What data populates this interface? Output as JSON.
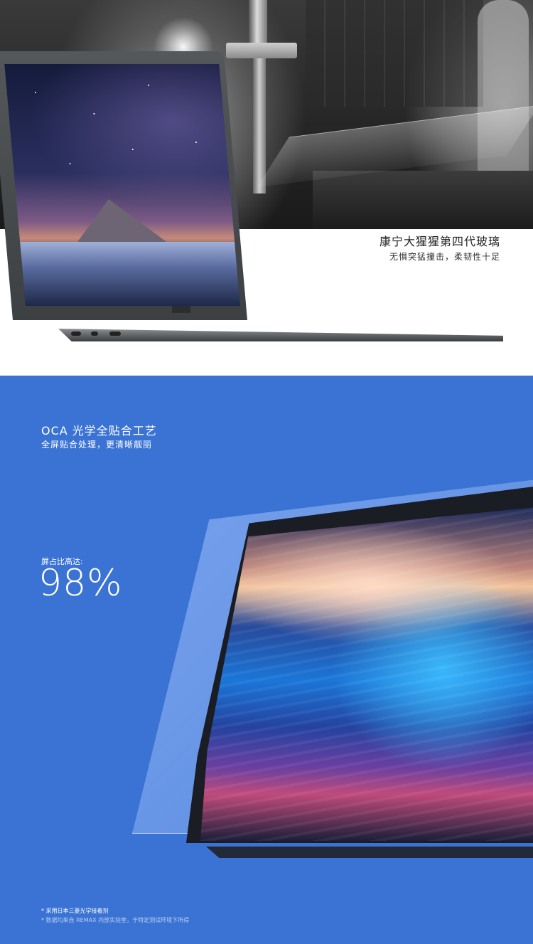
{
  "glass_section": {
    "title": "康宁大猩猩第四代玻璃",
    "subtitle": "无惧突猛撞击，柔韧性十足"
  },
  "oca_section": {
    "title": "OCA 光学全贴合工艺",
    "subtitle": "全屏贴合处理，更清晰靓丽",
    "ratio_label": "屏占比高达:",
    "ratio_value": "98%",
    "footnote_1": "* 采用日本三菱光学接着剂",
    "footnote_2": "* 数据均来自 REMAX 内部实验室，于特定测试环境下所得"
  },
  "colors": {
    "section2_background": "#3a73d4",
    "text_dark": "#222222",
    "text_light": "#ffffff"
  }
}
